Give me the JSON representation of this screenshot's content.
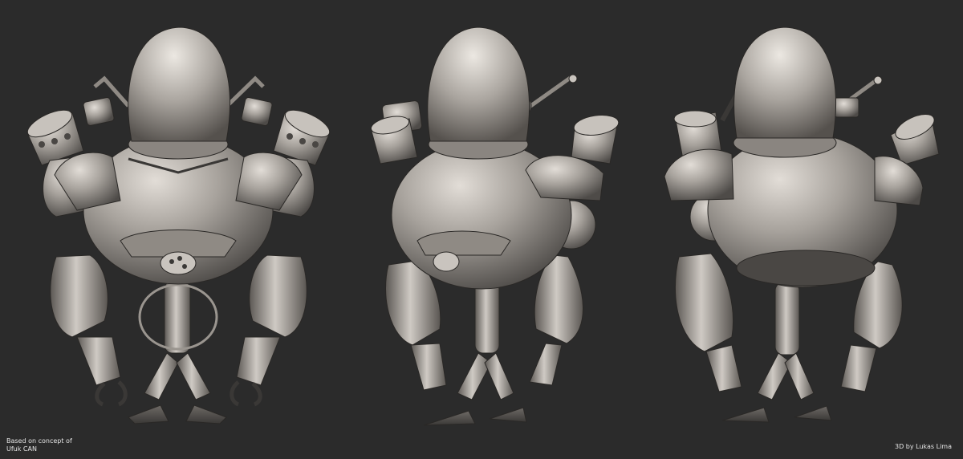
{
  "credits": {
    "concept_line1": "Based on concept of",
    "concept_line2": "Ufuk CAN",
    "author": "3D by Lukas Lima"
  },
  "colors": {
    "background": "#2b2b2b",
    "clay_light": "#d9d4ce",
    "clay_mid": "#a29d97",
    "clay_dark": "#5a5652",
    "outline": "#2a2826"
  },
  "views": [
    {
      "name": "front",
      "facing": "front"
    },
    {
      "name": "three-quarter",
      "facing": "three-quarter"
    },
    {
      "name": "back",
      "facing": "back"
    }
  ]
}
